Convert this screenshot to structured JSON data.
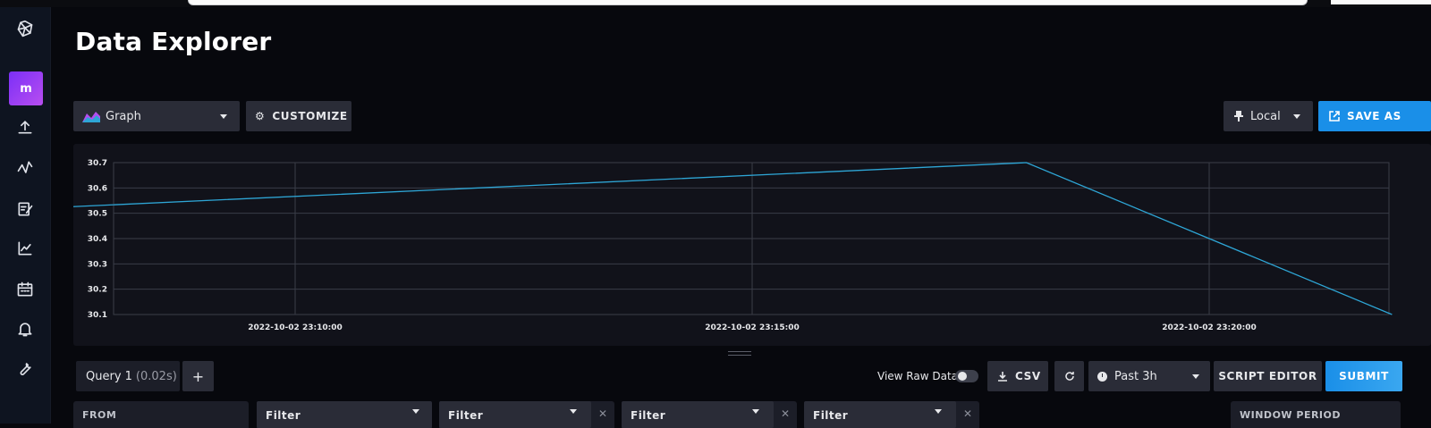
{
  "page": {
    "title": "Data Explorer"
  },
  "sidebar": {
    "org_initial": "m"
  },
  "toolbar": {
    "vis_type": "Graph",
    "customize_label": "CUSTOMIZE",
    "timezone": "Local",
    "save_as_label": "SAVE AS"
  },
  "query_bar": {
    "query_tab_name": "Query 1",
    "query_tab_time": "(0.02s)",
    "add_query_label": "+",
    "view_raw_label": "View Raw Data",
    "csv_label": "CSV",
    "time_range": "Past 3h",
    "script_editor_label": "SCRIPT EDITOR",
    "submit_label": "SUBMIT"
  },
  "builder": {
    "from_label": "FROM",
    "filter_label": "Filter",
    "window_period_label": "WINDOW PERIOD"
  },
  "colors": {
    "accent": "#1a8fe8",
    "line": "#2ea6d6",
    "org_badge": "#9b3ff5"
  },
  "chart_data": {
    "type": "line",
    "x": [
      "2022-10-02 23:06:00",
      "2022-10-02 23:18:00",
      "2022-10-02 23:22:00"
    ],
    "series": [
      {
        "values": [
          30.5,
          30.7,
          30.1
        ]
      }
    ],
    "xticks": [
      "2022-10-02 23:10:00",
      "2022-10-02 23:15:00",
      "2022-10-02 23:20:00"
    ],
    "yticks": [
      "30.1",
      "30.2",
      "30.3",
      "30.4",
      "30.5",
      "30.6",
      "30.7"
    ],
    "ylim": [
      30.1,
      30.7
    ],
    "grid": true
  }
}
